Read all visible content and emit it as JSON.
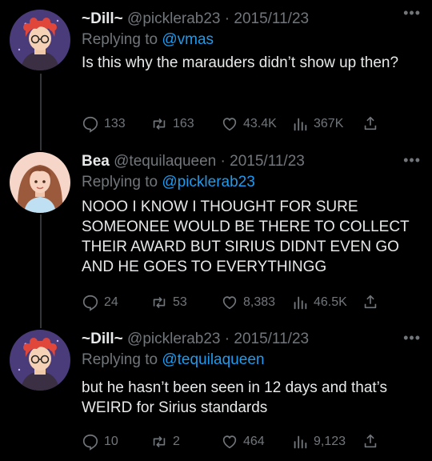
{
  "tweets": [
    {
      "name": "~Dill~",
      "handle": "@picklerab23",
      "separator": "·",
      "date": "2015/11/23",
      "replying_prefix": "Replying to",
      "replying_to": "@vmas",
      "text": "Is this why the marauders didn’t show up then?",
      "replies": "133",
      "retweets": "163",
      "likes": "43.4K",
      "views": "367K",
      "more": "•••"
    },
    {
      "name": "Bea",
      "handle": "@tequilaqueen",
      "separator": "·",
      "date": "2015/11/23",
      "replying_prefix": "Replying to",
      "replying_to": "@picklerab23",
      "text": "NOOO I KNOW I THOUGHT FOR SURE SOMEONEE WOULD BE THERE TO COLLECT THEIR AWARD BUT SIRIUS DIDNT EVEN GO AND HE GOES TO EVERYTHINGG",
      "replies": "24",
      "retweets": "53",
      "likes": "8,383",
      "views": "46.5K",
      "more": "•••"
    },
    {
      "name": "~Dill~",
      "handle": "@picklerab23",
      "separator": "·",
      "date": "2015/11/23",
      "replying_prefix": "Replying to",
      "replying_to": "@tequilaqueen",
      "text": "but he hasn’t been seen in 12 days and that’s WEIRD for Sirius standards",
      "replies": "10",
      "retweets": "2",
      "likes": "464",
      "views": "9,123",
      "more": "•••"
    }
  ],
  "icons": {
    "reply": "reply-icon",
    "retweet": "retweet-icon",
    "like": "heart-icon",
    "views": "views-icon",
    "share": "share-icon"
  },
  "colors": {
    "background": "#000000",
    "text": "#e7e9ea",
    "muted": "#71767b",
    "link": "#1d9bf0",
    "thread_line": "#333639"
  }
}
